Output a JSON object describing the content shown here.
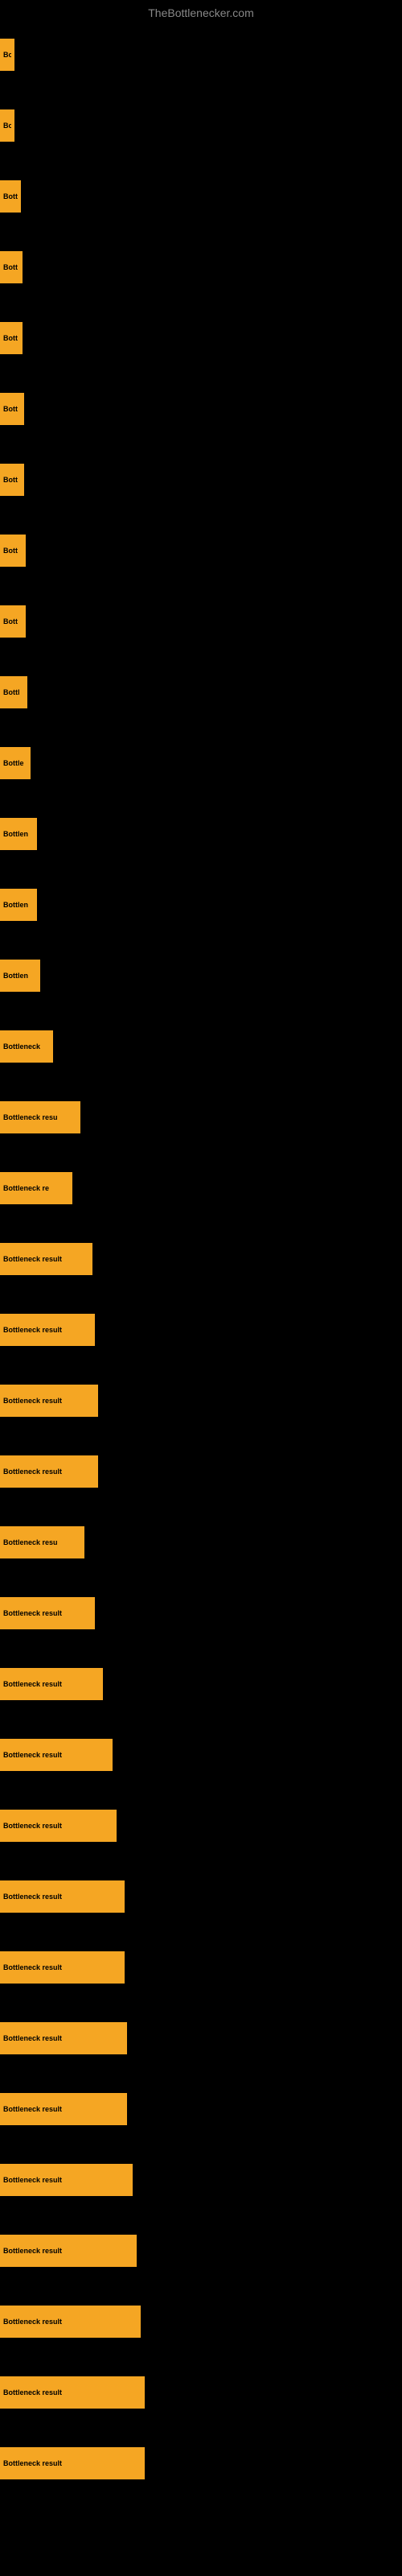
{
  "site": {
    "title": "TheBottlenecker.com"
  },
  "bars": [
    {
      "label": "Bo",
      "width": 18
    },
    {
      "label": "Bo",
      "width": 18
    },
    {
      "label": "Bott",
      "width": 26
    },
    {
      "label": "Bott",
      "width": 28
    },
    {
      "label": "Bott",
      "width": 28
    },
    {
      "label": "Bott",
      "width": 30
    },
    {
      "label": "Bott",
      "width": 30
    },
    {
      "label": "Bott",
      "width": 32
    },
    {
      "label": "Bott",
      "width": 32
    },
    {
      "label": "Bottl",
      "width": 34
    },
    {
      "label": "Bottle",
      "width": 38
    },
    {
      "label": "Bottlen",
      "width": 46
    },
    {
      "label": "Bottlen",
      "width": 46
    },
    {
      "label": "Bottlen",
      "width": 50
    },
    {
      "label": "Bottleneck",
      "width": 66
    },
    {
      "label": "Bottleneck resu",
      "width": 100
    },
    {
      "label": "Bottleneck re",
      "width": 90
    },
    {
      "label": "Bottleneck result",
      "width": 115
    },
    {
      "label": "Bottleneck result",
      "width": 118
    },
    {
      "label": "Bottleneck result",
      "width": 122
    },
    {
      "label": "Bottleneck result",
      "width": 122
    },
    {
      "label": "Bottleneck resu",
      "width": 105
    },
    {
      "label": "Bottleneck result",
      "width": 118
    },
    {
      "label": "Bottleneck result",
      "width": 128
    },
    {
      "label": "Bottleneck result",
      "width": 140
    },
    {
      "label": "Bottleneck result",
      "width": 145
    },
    {
      "label": "Bottleneck result",
      "width": 155
    },
    {
      "label": "Bottleneck result",
      "width": 155
    },
    {
      "label": "Bottleneck result",
      "width": 158
    },
    {
      "label": "Bottleneck result",
      "width": 158
    },
    {
      "label": "Bottleneck result",
      "width": 165
    },
    {
      "label": "Bottleneck result",
      "width": 170
    },
    {
      "label": "Bottleneck result",
      "width": 175
    },
    {
      "label": "Bottleneck result",
      "width": 180
    },
    {
      "label": "Bottleneck result",
      "width": 180
    }
  ]
}
